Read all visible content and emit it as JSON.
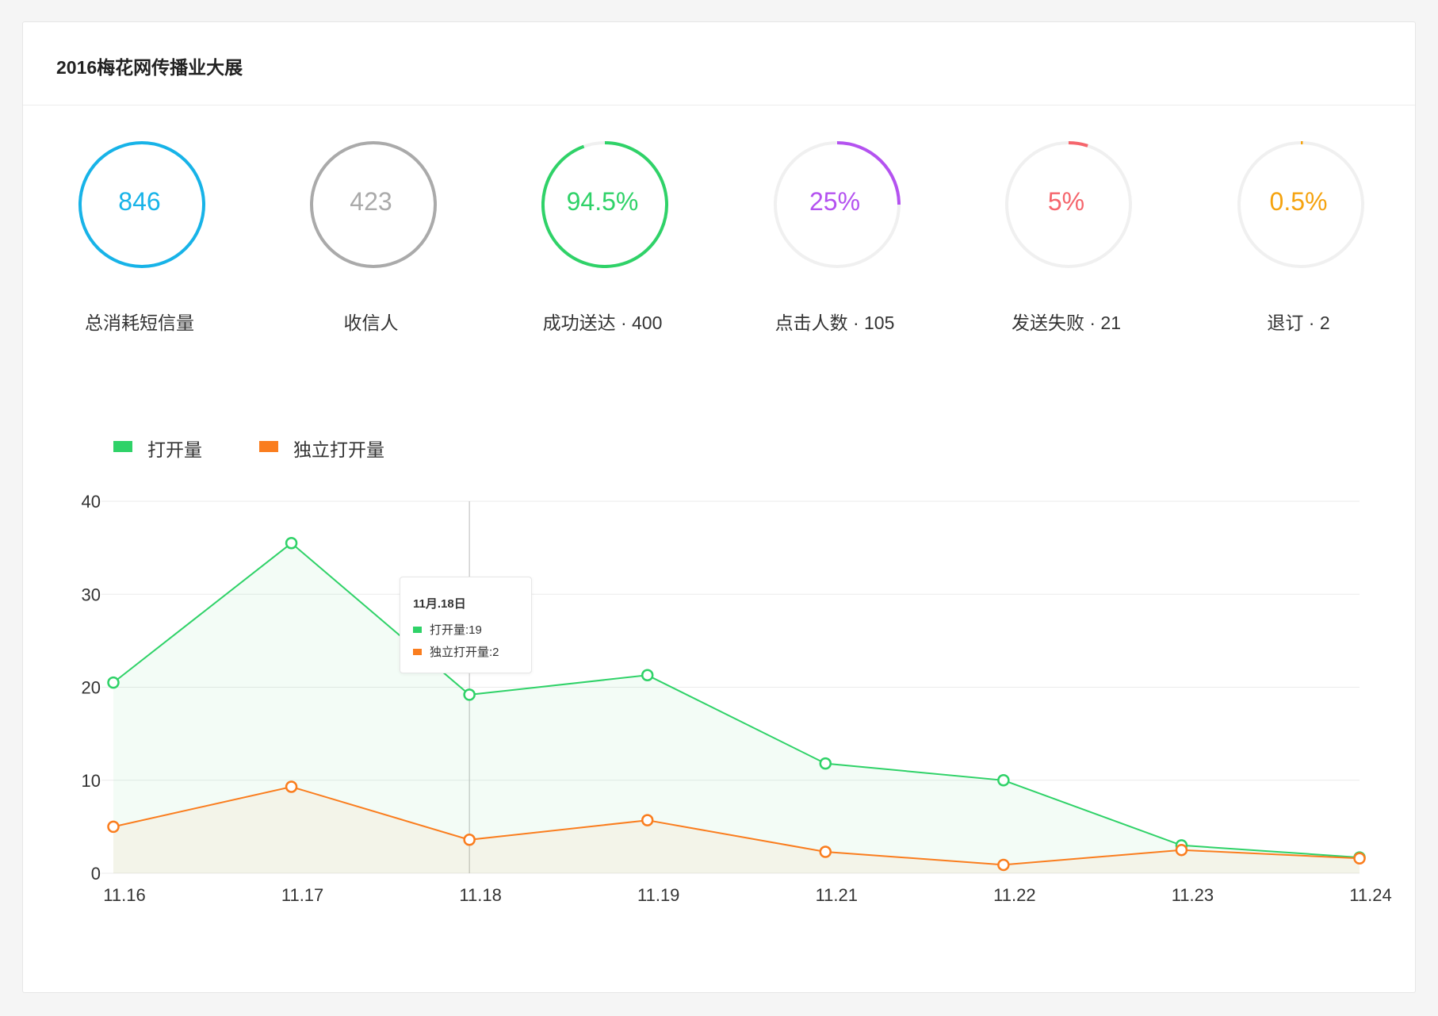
{
  "card": {
    "title": "2016梅花网传播业大展"
  },
  "stats": [
    {
      "value": "846",
      "label": "总消耗短信量",
      "color": "#17b3e8",
      "fraction": 1.0
    },
    {
      "value": "423",
      "label": "收信人",
      "color": "#aaaaaa",
      "fraction": 1.0
    },
    {
      "value": "94.5%",
      "label": "成功送达 · 400",
      "color": "#2fd268",
      "fraction": 0.945
    },
    {
      "value": "25%",
      "label": "点击人数 · 105",
      "color": "#b452f0",
      "fraction": 0.25
    },
    {
      "value": "5%",
      "label": "发送失败 · 21",
      "color": "#f5656c",
      "fraction": 0.05
    },
    {
      "value": "0.5%",
      "label": "退订 · 2",
      "color": "#f5a30f",
      "fraction": 0.005
    }
  ],
  "ring_track_color": "#f0f0f0",
  "tooltip": {
    "title": "11月.18日",
    "rows": [
      "打开量:19",
      "独立打开量:2"
    ]
  },
  "chart_data": {
    "type": "line",
    "categories": [
      "11.16",
      "11.17",
      "11.18",
      "11.19",
      "11.21",
      "11.22",
      "11.23",
      "11.24"
    ],
    "series": [
      {
        "name": "打开量",
        "color": "#2fd268",
        "values": [
          20.5,
          35.5,
          19.2,
          21.3,
          11.8,
          10,
          3,
          1.7
        ]
      },
      {
        "name": "独立打开量",
        "color": "#fa7d1e",
        "values": [
          5,
          9.3,
          3.6,
          5.7,
          2.3,
          0.9,
          2.5,
          1.6
        ]
      }
    ],
    "ylim": [
      0,
      40
    ],
    "yticks": [
      "0",
      "10",
      "20",
      "30",
      "40"
    ],
    "title": "",
    "xlabel": "",
    "ylabel": "",
    "area_fill": true,
    "grid": true,
    "legend_position": "top-left",
    "highlight_category": "11.18"
  }
}
